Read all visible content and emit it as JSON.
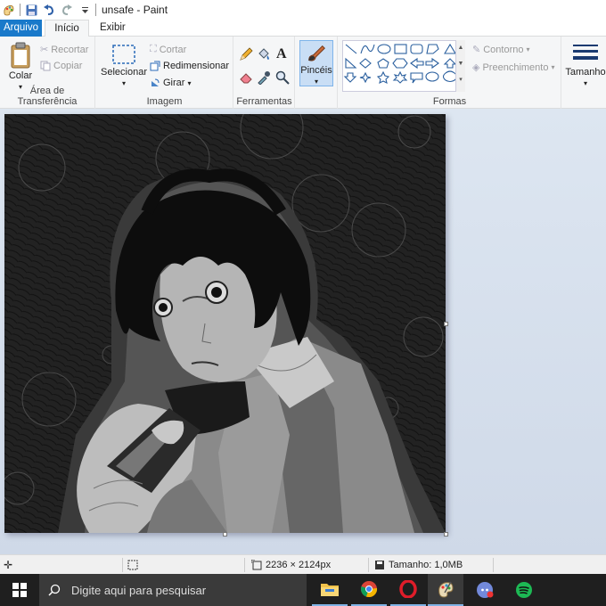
{
  "titlebar": {
    "title": "unsafe - Paint"
  },
  "tabs": {
    "file": "Arquivo",
    "home": "Início",
    "view": "Exibir"
  },
  "clipboard": {
    "paste": "Colar",
    "cut": "Recortar",
    "copy": "Copiar",
    "label": "Área de Transferência"
  },
  "image": {
    "select": "Selecionar",
    "crop": "Cortar",
    "resize": "Redimensionar",
    "rotate": "Girar",
    "label": "Imagem"
  },
  "tools": {
    "label": "Ferramentas"
  },
  "brushes": {
    "label": "Pincéis"
  },
  "shapes": {
    "outline": "Contorno",
    "fill": "Preenchimento",
    "label": "Formas"
  },
  "size": {
    "label": "Tamanho"
  },
  "status": {
    "dimensions": "2236 × 2124px",
    "filesize": "Tamanho: 1,0MB"
  },
  "taskbar": {
    "search_placeholder": "Digite aqui para pesquisar"
  },
  "colors": {
    "accent": "#1979ca",
    "ribbon": "#f5f6f7",
    "canvas_bg": "#d6dfec",
    "taskbar": "#1f1f1f"
  }
}
